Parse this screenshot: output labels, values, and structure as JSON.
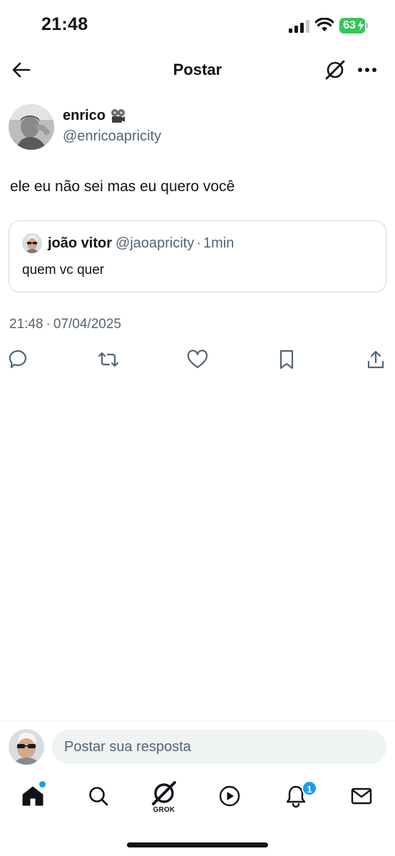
{
  "status_bar": {
    "time": "21:48",
    "battery": "63"
  },
  "header": {
    "title": "Postar"
  },
  "post": {
    "author_name": "enrico",
    "author_handle": "@enricoapricity",
    "text": "ele eu não sei mas eu quero você",
    "time": "21:48",
    "date": "07/04/2025",
    "meta_separator": "·"
  },
  "quote": {
    "name": "joão vitor",
    "handle": "@jaoapricity",
    "separator": "·",
    "time": "1min",
    "text": "quem vc quer"
  },
  "reply": {
    "placeholder": "Postar sua resposta"
  },
  "nav": {
    "grok_label": "GROK",
    "notifications_badge": "1"
  },
  "colors": {
    "text_primary": "#0f1419",
    "text_secondary": "#536471",
    "accent": "#1d9bf0",
    "border": "#cfd9de",
    "input_bg": "#eff3f4",
    "battery": "#34c759"
  },
  "icons": {
    "back": "arrow-left-icon",
    "grok": "grok-icon",
    "more": "more-dots-icon",
    "reply": "reply-icon",
    "repost": "repost-icon",
    "like": "heart-icon",
    "bookmark": "bookmark-icon",
    "share": "share-icon",
    "home": "home-icon",
    "search": "search-icon",
    "video": "play-icon",
    "notifications": "bell-icon",
    "messages": "envelope-icon"
  }
}
